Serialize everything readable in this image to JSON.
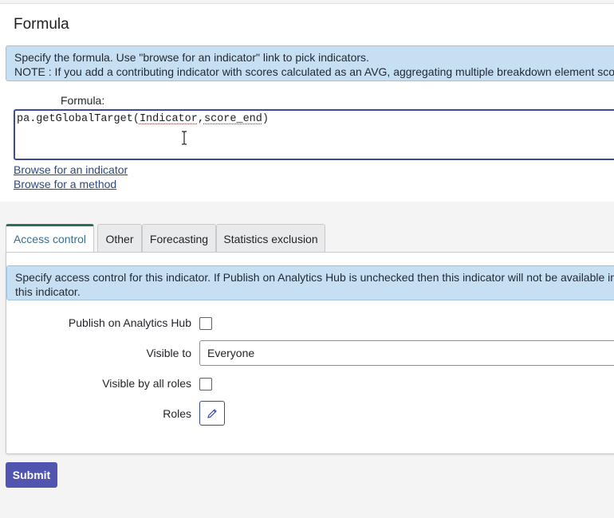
{
  "formula_section": {
    "title": "Formula",
    "info_line1": "Specify the formula. Use \"browse for an indicator\" link to pick indicators.",
    "info_line2": "NOTE : If you add a contributing indicator with scores calculated as an AVG, aggregating multiple breakdown element scores",
    "field_label": "Formula:",
    "value_prefix": "pa.getGlobalTarget(",
    "value_arg1": "Indicator",
    "value_comma": ",",
    "value_arg2": "score_end",
    "value_suffix": ")",
    "browse_indicator": "Browse for an indicator",
    "browse_method": "Browse for a method"
  },
  "tabs": [
    {
      "label": "Access control",
      "active": true
    },
    {
      "label": "Other",
      "active": false
    },
    {
      "label": "Forecasting",
      "active": false
    },
    {
      "label": "Statistics exclusion",
      "active": false
    }
  ],
  "access_control": {
    "info_line1": "Specify access control for this indicator. If Publish on Analytics Hub is unchecked then this indicator will not be available in A",
    "info_line2": "this indicator.",
    "publish_label": "Publish on Analytics Hub",
    "publish_checked": false,
    "visible_to_label": "Visible to",
    "visible_to_value": "Everyone",
    "visible_all_roles_label": "Visible by all roles",
    "visible_all_roles_checked": false,
    "roles_label": "Roles"
  },
  "submit_label": "Submit",
  "colors": {
    "primary": "#5155b0",
    "info_bg": "#c7dff2",
    "active_tab_accent": "#2f6b5a",
    "link": "#2d4a7a"
  }
}
